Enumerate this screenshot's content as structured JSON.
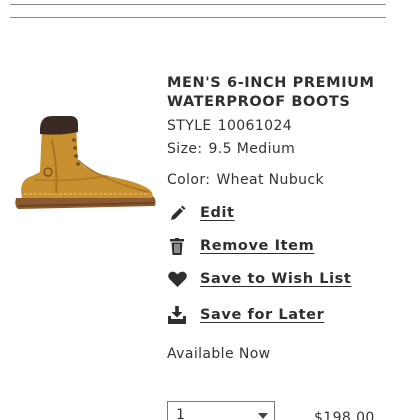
{
  "product": {
    "title": "MEN'S 6-INCH PREMIUM WATERPROOF BOOTS",
    "style_label": "STYLE",
    "style_number": "10061024",
    "size_label": "Size:",
    "size_value": "9.5 Medium",
    "color_label": "Color:",
    "color_value": "Wheat Nubuck",
    "image_icon": "wheat-boot-image"
  },
  "actions": {
    "edit": {
      "label": "Edit",
      "icon": "pencil-icon"
    },
    "remove": {
      "label": "Remove Item",
      "icon": "trash-icon"
    },
    "wishlist": {
      "label": "Save to Wish List",
      "icon": "heart-icon"
    },
    "later": {
      "label": "Save for Later",
      "icon": "download-tray-icon"
    }
  },
  "availability": "Available Now",
  "quantity": {
    "value": "1"
  },
  "price": "$198.00",
  "colors": {
    "text": "#2f2f2f",
    "boot_wheat": "#c8902f",
    "boot_collar": "#3a2a22",
    "sole": "#8a5a2e"
  }
}
